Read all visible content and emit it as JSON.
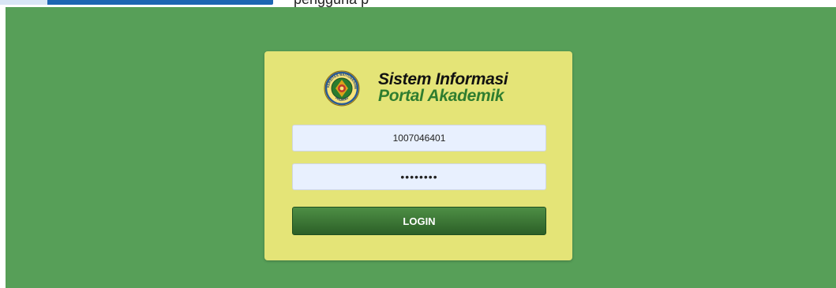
{
  "header_partial_text": "pengguna p",
  "brand": {
    "title_line1": "Sistem Informasi",
    "title_line2": "Portal Akademik",
    "logo_ring_text": "UNIVERSITAS BAITURRAHMAH",
    "logo_bottom_text": "PADANG"
  },
  "login_form": {
    "username_value": "1007046401",
    "password_value": "••••••••",
    "login_button_label": "LOGIN"
  },
  "colors": {
    "background_green": "#579f58",
    "card_yellow": "#e4e477",
    "input_fill": "#e8f0fe",
    "button_green": "#2c5f27",
    "brand_green": "#2f7d2f",
    "header_blue": "#1e66b3"
  }
}
